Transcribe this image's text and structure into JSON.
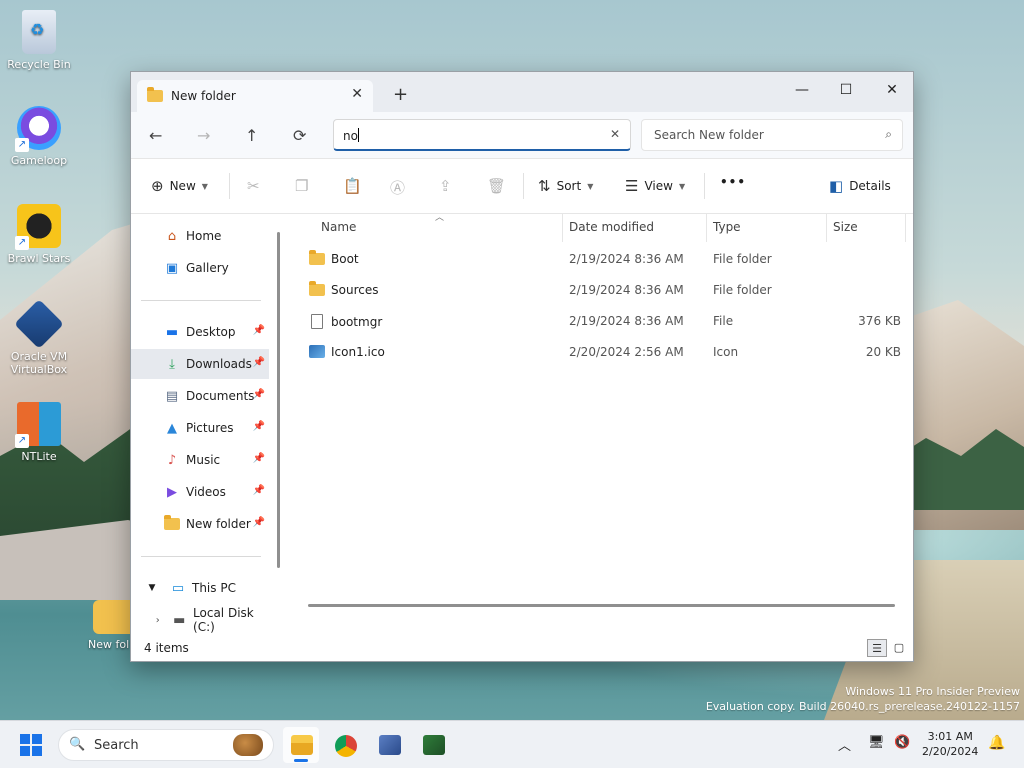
{
  "desktop": {
    "icons": [
      {
        "label": "Recycle Bin"
      },
      {
        "label": "Gameloop"
      },
      {
        "label": "Brawl Stars"
      },
      {
        "label": "Oracle VM\nVirtualBox"
      },
      {
        "label": "NTLite"
      },
      {
        "label": "New fol"
      }
    ],
    "watermark": {
      "line1": "Windows 11 Pro Insider Preview",
      "line2": "Evaluation copy. Build 26040.rs_prerelease.240122-1157"
    }
  },
  "window": {
    "tab_title": "New folder",
    "address_value": "no",
    "search_placeholder": "Search New folder",
    "toolbar": {
      "new_label": "New",
      "sort_label": "Sort",
      "view_label": "View",
      "more_label": "•••",
      "details_label": "Details"
    },
    "sidebar": {
      "quick": [
        {
          "label": "Home",
          "icon": "home-icon"
        },
        {
          "label": "Gallery",
          "icon": "gallery-icon"
        }
      ],
      "pinned": [
        {
          "label": "Desktop",
          "icon": "desktop-icon"
        },
        {
          "label": "Downloads",
          "icon": "download-icon",
          "selected": true
        },
        {
          "label": "Documents",
          "icon": "documents-icon"
        },
        {
          "label": "Pictures",
          "icon": "pictures-icon"
        },
        {
          "label": "Music",
          "icon": "music-icon"
        },
        {
          "label": "Videos",
          "icon": "videos-icon"
        },
        {
          "label": "New folder",
          "icon": "folder-icon"
        }
      ],
      "this_pc": "This PC",
      "local_disk": "Local Disk (C:)"
    },
    "columns": {
      "name": "Name",
      "date": "Date modified",
      "type": "Type",
      "size": "Size"
    },
    "files": [
      {
        "name": "Boot",
        "date": "2/19/2024 8:36 AM",
        "type": "File folder",
        "size": "",
        "kind": "folder"
      },
      {
        "name": "Sources",
        "date": "2/19/2024 8:36 AM",
        "type": "File folder",
        "size": "",
        "kind": "folder"
      },
      {
        "name": "bootmgr",
        "date": "2/19/2024 8:36 AM",
        "type": "File",
        "size": "376 KB",
        "kind": "file"
      },
      {
        "name": "Icon1.ico",
        "date": "2/20/2024 2:56 AM",
        "type": "Icon",
        "size": "20 KB",
        "kind": "icon"
      }
    ],
    "status": "4 items"
  },
  "taskbar": {
    "search_placeholder": "Search",
    "time": "3:01 AM",
    "date": "2/20/2024"
  }
}
